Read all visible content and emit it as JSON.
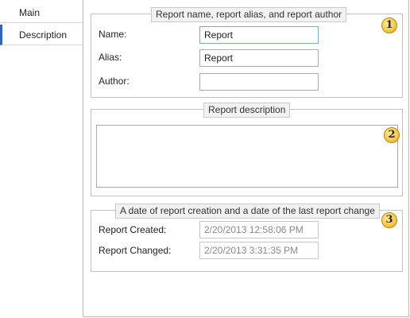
{
  "nav": {
    "items": [
      {
        "label": "Main"
      },
      {
        "label": "Description"
      }
    ]
  },
  "groups": {
    "names": {
      "title": "Report name, report alias, and report author",
      "badge": "1",
      "name_label": "Name:",
      "name_value": "Report",
      "alias_label": "Alias:",
      "alias_value": "Report",
      "author_label": "Author:",
      "author_value": ""
    },
    "description": {
      "title": "Report description",
      "badge": "2",
      "value": ""
    },
    "dates": {
      "title": "A date of report creation and a date of the last report change",
      "badge": "3",
      "created_label": "Report Created:",
      "created_value": "2/20/2013 12:58:06 PM",
      "changed_label": "Report Changed:",
      "changed_value": "2/20/2013 3:31:35 PM"
    }
  },
  "colors": {
    "selected_accent": "#2f67b5",
    "badge": "#f6c746"
  }
}
